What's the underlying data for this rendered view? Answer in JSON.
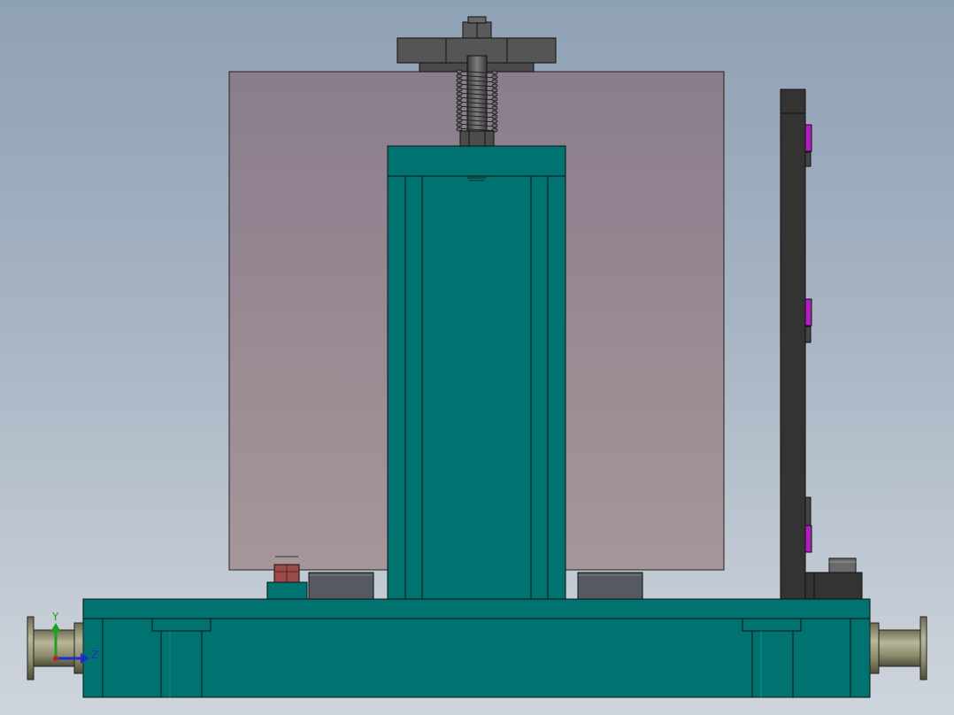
{
  "viewport": {
    "background_top": "#8fa1b5",
    "background_bottom": "#cfd5dc"
  },
  "colors": {
    "body_teal": "#007370",
    "body_teal_dark": "#005c59",
    "panel_mauve": "#978088",
    "dark_gray": "#333333",
    "nut_gray": "#555555",
    "magenta_clip": "#b01ec0",
    "fitting_olive": "#8d8b6c",
    "red_fitting": "#9a4a48",
    "axis_y": "#1ea01e",
    "axis_z": "#1e2ec8"
  },
  "triad": {
    "y_label": "Y",
    "z_label": "Z"
  }
}
